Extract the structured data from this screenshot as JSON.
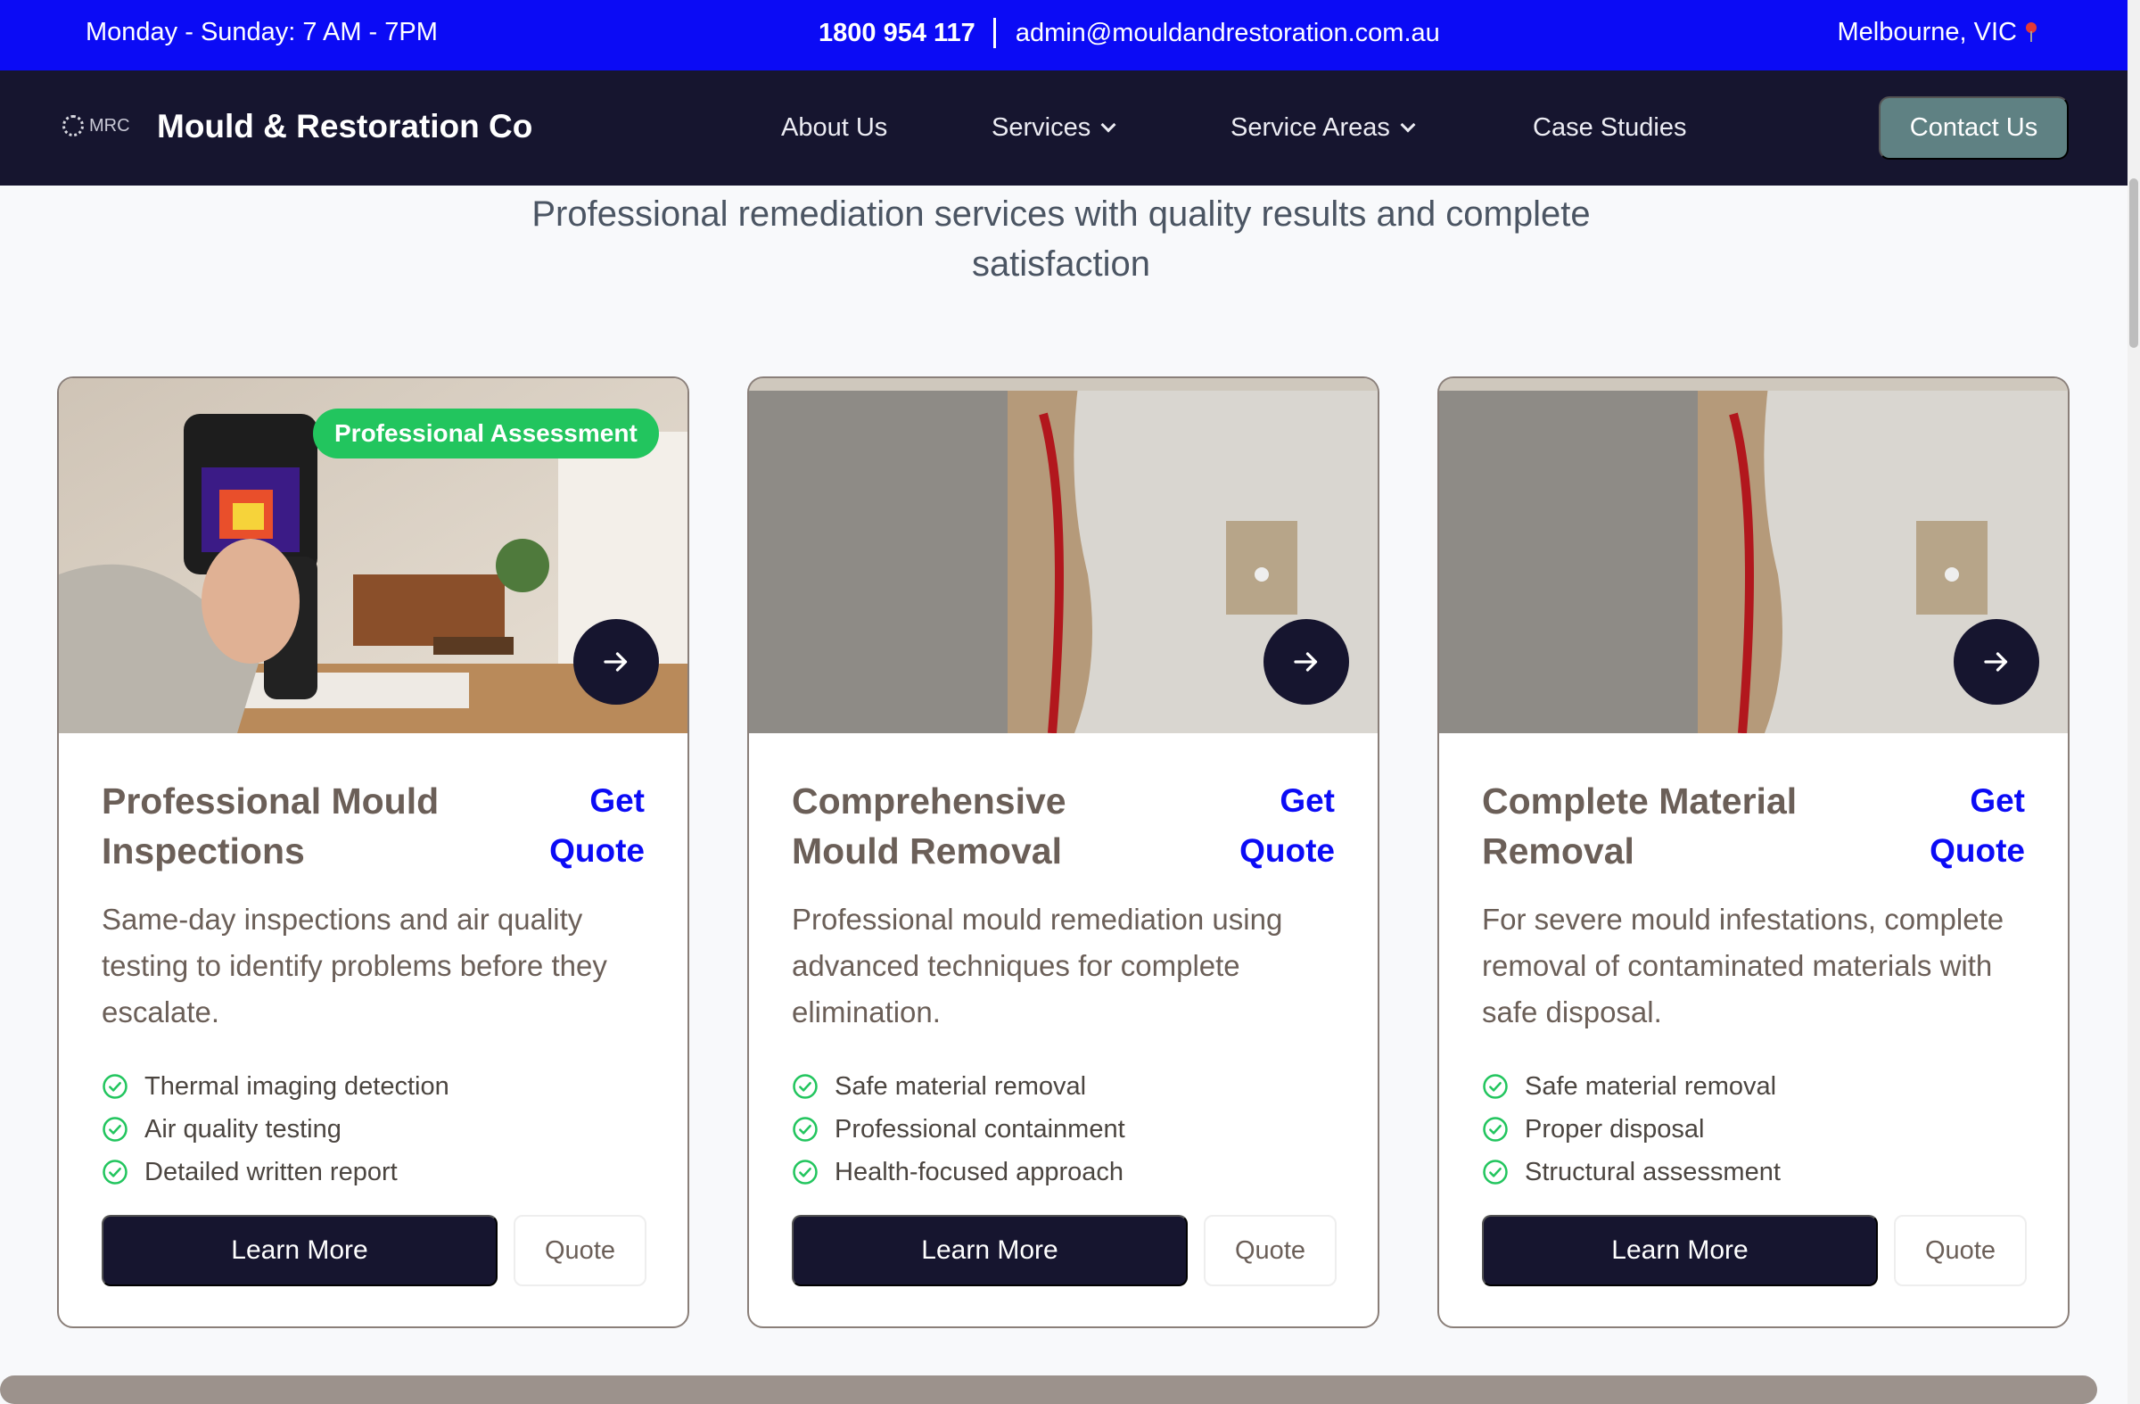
{
  "topbar": {
    "hours": "Monday - Sunday: 7 AM - 7PM",
    "phone": "1800 954 117",
    "email": "admin@mouldandrestoration.com.au",
    "location": "Melbourne, VIC",
    "location_icon": "map-pin-icon"
  },
  "nav": {
    "logo_text": "MRC",
    "brand": "Mould & Restoration Co",
    "items": [
      {
        "label": "About Us"
      },
      {
        "label": "Services"
      },
      {
        "label": "Service Areas"
      },
      {
        "label": "Case Studies"
      }
    ],
    "cta": "Contact Us"
  },
  "section": {
    "subtitle": "Professional remediation services with quality results and complete satisfaction"
  },
  "cards": [
    {
      "badge": "Professional Assessment",
      "title": "Professional Mould Inspections",
      "get_quote": "Get Quote",
      "description": "Same-day inspections and air quality testing to identify problems before they escalate.",
      "features": [
        "Thermal imaging detection",
        "Air quality testing",
        "Detailed written report"
      ],
      "learn_more": "Learn More",
      "quote": "Quote"
    },
    {
      "title": "Comprehensive Mould Removal",
      "get_quote": "Get Quote",
      "description": "Professional mould remediation using advanced techniques for complete elimination.",
      "features": [
        "Safe material removal",
        "Professional containment",
        "Health-focused approach"
      ],
      "learn_more": "Learn More",
      "quote": "Quote"
    },
    {
      "title": "Complete Material Removal",
      "get_quote": "Get Quote",
      "description": "For severe mould infestations, complete removal of contaminated materials with safe disposal.",
      "features": [
        "Safe material removal",
        "Proper disposal",
        "Structural assessment"
      ],
      "learn_more": "Learn More",
      "quote": "Quote"
    }
  ],
  "colors": {
    "topbar": "#0b0bf5",
    "navbar": "#16152f",
    "cta": "#5f8183",
    "badge": "#22c55e",
    "check": "#22c55e"
  }
}
